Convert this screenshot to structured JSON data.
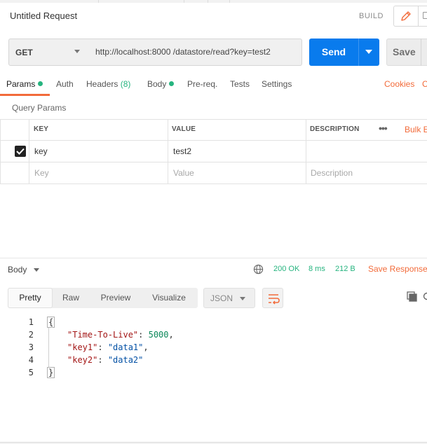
{
  "request": {
    "title": "Untitled Request",
    "build_label": "BUILD",
    "method": "GET",
    "url": "http://localhost:8000 /datastore/read?key=test2",
    "send_label": "Send",
    "save_label": "Save"
  },
  "tabs": {
    "params": "Params",
    "auth": "Auth",
    "headers": "Headers",
    "headers_count": "(8)",
    "body": "Body",
    "prereq": "Pre-req.",
    "tests": "Tests",
    "settings": "Settings",
    "cookies": "Cookies",
    "code_cut": "C"
  },
  "query_params": {
    "title": "Query Params",
    "columns": {
      "key": "KEY",
      "value": "VALUE",
      "description": "DESCRIPTION"
    },
    "bulk_edit": "Bulk E",
    "rows": [
      {
        "key": "key",
        "value": "test2",
        "description": "",
        "checked": true
      }
    ],
    "placeholder": {
      "key": "Key",
      "value": "Value",
      "description": "Description"
    }
  },
  "response": {
    "section_label": "Body",
    "status": "200 OK",
    "time": "8 ms",
    "size": "212 B",
    "save_response": "Save Response",
    "views": [
      "Pretty",
      "Raw",
      "Preview",
      "Visualize"
    ],
    "active_view": "Pretty",
    "format": "JSON",
    "line_numbers": [
      "1",
      "2",
      "3",
      "4",
      "5"
    ],
    "json": {
      "open": "{",
      "close": "}",
      "entries": [
        {
          "key": "\"Time-To-Live\"",
          "value": "5000",
          "type": "number",
          "comma": ","
        },
        {
          "key": "\"key1\"",
          "value": "\"data1\"",
          "type": "string",
          "comma": ","
        },
        {
          "key": "\"key2\"",
          "value": "\"data2\"",
          "type": "string",
          "comma": ""
        }
      ]
    }
  },
  "icons": {
    "edit": "pencil-icon",
    "mode_alt": "document-icon",
    "dropdown": "chevron-down-icon",
    "check": "check-icon",
    "more": "more-horizontal-icon",
    "globe": "globe-icon",
    "wrap": "wrap-lines-icon",
    "copy": "copy-icon",
    "search": "search-icon"
  },
  "colors": {
    "accent": "#f26b3a",
    "primary": "#097bed",
    "success": "#26b47f"
  }
}
